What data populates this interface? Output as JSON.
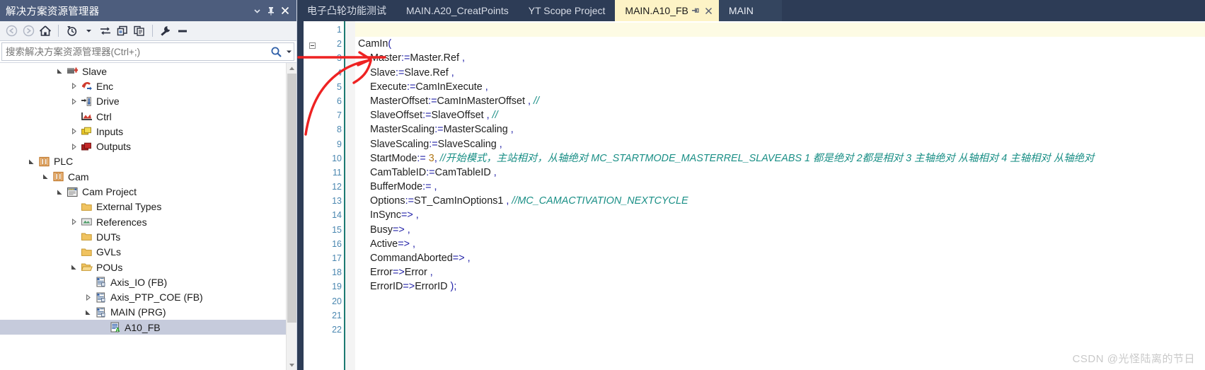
{
  "solution_explorer": {
    "title": "解决方案资源管理器",
    "titlebar_buttons": [
      {
        "name": "dropdown",
        "glyph": "▾"
      },
      {
        "name": "pin",
        "glyph": "⊓"
      },
      {
        "name": "close",
        "glyph": "✕"
      }
    ],
    "toolbar": [
      {
        "name": "back-icon",
        "glyph": "back"
      },
      {
        "name": "forward-icon",
        "glyph": "forward"
      },
      {
        "name": "home-icon",
        "glyph": "home"
      },
      {
        "name": "pending-changes-icon",
        "glyph": "clock"
      },
      {
        "name": "sync-icon",
        "glyph": "sync"
      },
      {
        "name": "show-all-files-icon",
        "glyph": "files"
      },
      {
        "name": "properties-icon",
        "glyph": "copy"
      },
      {
        "name": "tools-icon",
        "glyph": "wrench"
      },
      {
        "name": "collapse-icon",
        "glyph": "dash"
      }
    ],
    "search": {
      "placeholder": "搜索解决方案资源管理器(Ctrl+;)",
      "value": ""
    },
    "tree": [
      {
        "label": "Slave",
        "depth": 3,
        "expander": "expanded",
        "icon": "slave-icon",
        "selected": false
      },
      {
        "label": "Enc",
        "depth": 4,
        "expander": "collapsed",
        "icon": "encoder-icon",
        "selected": false
      },
      {
        "label": "Drive",
        "depth": 4,
        "expander": "collapsed",
        "icon": "drive-icon",
        "selected": false
      },
      {
        "label": "Ctrl",
        "depth": 4,
        "expander": "none",
        "icon": "ctrl-icon",
        "selected": false
      },
      {
        "label": "Inputs",
        "depth": 4,
        "expander": "collapsed",
        "icon": "inputs-icon",
        "selected": false
      },
      {
        "label": "Outputs",
        "depth": 4,
        "expander": "collapsed",
        "icon": "outputs-icon",
        "selected": false
      },
      {
        "label": "PLC",
        "depth": 1,
        "expander": "expanded",
        "icon": "plc-icon",
        "selected": false
      },
      {
        "label": "Cam",
        "depth": 2,
        "expander": "expanded",
        "icon": "plc-icon",
        "selected": false
      },
      {
        "label": "Cam Project",
        "depth": 3,
        "expander": "expanded",
        "icon": "project-icon",
        "selected": false
      },
      {
        "label": "External Types",
        "depth": 4,
        "expander": "none",
        "icon": "folder-icon",
        "selected": false
      },
      {
        "label": "References",
        "depth": 4,
        "expander": "collapsed",
        "icon": "references-icon",
        "selected": false
      },
      {
        "label": "DUTs",
        "depth": 4,
        "expander": "none",
        "icon": "folder-icon",
        "selected": false
      },
      {
        "label": "GVLs",
        "depth": 4,
        "expander": "none",
        "icon": "folder-icon",
        "selected": false
      },
      {
        "label": "POUs",
        "depth": 4,
        "expander": "expanded",
        "icon": "folder-open-icon",
        "selected": false
      },
      {
        "label": "Axis_IO (FB)",
        "depth": 5,
        "expander": "none",
        "icon": "pou-icon",
        "selected": false
      },
      {
        "label": "Axis_PTP_COE (FB)",
        "depth": 5,
        "expander": "collapsed",
        "icon": "pou-icon",
        "selected": false
      },
      {
        "label": "MAIN (PRG)",
        "depth": 5,
        "expander": "expanded",
        "icon": "pou-icon",
        "selected": false
      },
      {
        "label": "A10_FB",
        "depth": 6,
        "expander": "none",
        "icon": "action-icon",
        "selected": true
      }
    ]
  },
  "tabs": [
    {
      "label": "电子凸轮功能测试",
      "state": "inactive",
      "pinned": false,
      "closable": false
    },
    {
      "label": "MAIN.A20_CreatPoints",
      "state": "inactive",
      "pinned": false,
      "closable": false
    },
    {
      "label": "YT Scope Project",
      "state": "inactive",
      "pinned": false,
      "closable": false
    },
    {
      "label": "MAIN.A10_FB",
      "state": "active",
      "pinned": true,
      "closable": true
    },
    {
      "label": "MAIN",
      "state": "current",
      "pinned": false,
      "closable": false
    }
  ],
  "tab_glyphs": {
    "pin": "⊣",
    "close": "✕"
  },
  "editor": {
    "lines": [
      {
        "num": "1",
        "indent": 0,
        "highlight": true,
        "segments": []
      },
      {
        "num": "2",
        "indent": 0,
        "highlight": false,
        "fold": true,
        "segments": [
          {
            "t": "CamIn",
            "c": "plain"
          },
          {
            "t": "(",
            "c": "punc"
          }
        ]
      },
      {
        "num": "3",
        "indent": 1,
        "highlight": false,
        "segments": [
          {
            "t": "Master",
            "c": "plain"
          },
          {
            "t": ":=",
            "c": "op"
          },
          {
            "t": "Master.Ref",
            "c": "plain"
          },
          {
            "t": " ,",
            "c": "punc"
          }
        ]
      },
      {
        "num": "4",
        "indent": 1,
        "highlight": false,
        "segments": [
          {
            "t": "Slave",
            "c": "plain"
          },
          {
            "t": ":=",
            "c": "op"
          },
          {
            "t": "Slave.Ref",
            "c": "plain"
          },
          {
            "t": "  ,",
            "c": "punc"
          }
        ]
      },
      {
        "num": "5",
        "indent": 1,
        "highlight": false,
        "segments": [
          {
            "t": "Execute",
            "c": "plain"
          },
          {
            "t": ":=",
            "c": "op"
          },
          {
            "t": "CamInExecute",
            "c": "plain"
          },
          {
            "t": " ,",
            "c": "punc"
          }
        ]
      },
      {
        "num": "6",
        "indent": 1,
        "highlight": false,
        "segments": [
          {
            "t": "MasterOffset",
            "c": "plain"
          },
          {
            "t": ":=",
            "c": "op"
          },
          {
            "t": "CamInMasterOffset",
            "c": "plain"
          },
          {
            "t": " ,",
            "c": "punc"
          },
          {
            "t": " //",
            "c": "cmt"
          }
        ]
      },
      {
        "num": "7",
        "indent": 1,
        "highlight": false,
        "segments": [
          {
            "t": "SlaveOffset",
            "c": "plain"
          },
          {
            "t": ":=",
            "c": "op"
          },
          {
            "t": "SlaveOffset",
            "c": "plain"
          },
          {
            "t": " ,",
            "c": "punc"
          },
          {
            "t": " //",
            "c": "cmt"
          }
        ]
      },
      {
        "num": "8",
        "indent": 1,
        "highlight": false,
        "segments": [
          {
            "t": "MasterScaling",
            "c": "plain"
          },
          {
            "t": ":=",
            "c": "op"
          },
          {
            "t": "MasterScaling",
            "c": "plain"
          },
          {
            "t": " ,",
            "c": "punc"
          }
        ]
      },
      {
        "num": "9",
        "indent": 1,
        "highlight": false,
        "segments": [
          {
            "t": "SlaveScaling",
            "c": "plain"
          },
          {
            "t": ":=",
            "c": "op"
          },
          {
            "t": "SlaveScaling",
            "c": "plain"
          },
          {
            "t": " ,",
            "c": "punc"
          }
        ]
      },
      {
        "num": "10",
        "indent": 1,
        "highlight": false,
        "segments": [
          {
            "t": "StartMode",
            "c": "plain"
          },
          {
            "t": ":=",
            "c": "op"
          },
          {
            "t": " 3",
            "c": "num"
          },
          {
            "t": ",",
            "c": "punc"
          },
          {
            "t": " //开始模式，主站相对，从轴绝对  MC_STARTMODE_MASTERREL_SLAVEABS  1 都是绝对  2都是相对 3 主轴绝对 从轴相对  4 主轴相对 从轴绝对",
            "c": "cmt"
          }
        ]
      },
      {
        "num": "11",
        "indent": 1,
        "highlight": false,
        "segments": [
          {
            "t": "CamTableID",
            "c": "plain"
          },
          {
            "t": ":=",
            "c": "op"
          },
          {
            "t": "CamTableID",
            "c": "plain"
          },
          {
            "t": " ,",
            "c": "punc"
          }
        ]
      },
      {
        "num": "12",
        "indent": 1,
        "highlight": false,
        "segments": [
          {
            "t": "BufferMode",
            "c": "plain"
          },
          {
            "t": ":=",
            "c": "op"
          },
          {
            "t": " ,",
            "c": "punc"
          }
        ]
      },
      {
        "num": "13",
        "indent": 1,
        "highlight": false,
        "segments": [
          {
            "t": "Options",
            "c": "plain"
          },
          {
            "t": ":=",
            "c": "op"
          },
          {
            "t": "ST_CamInOptions1",
            "c": "plain"
          },
          {
            "t": " ,",
            "c": "punc"
          },
          {
            "t": " //MC_CAMACTIVATION_NEXTCYCLE",
            "c": "cmt"
          }
        ]
      },
      {
        "num": "14",
        "indent": 1,
        "highlight": false,
        "segments": [
          {
            "t": "InSync",
            "c": "plain"
          },
          {
            "t": "=>",
            "c": "op"
          },
          {
            "t": " ,",
            "c": "punc"
          }
        ]
      },
      {
        "num": "15",
        "indent": 1,
        "highlight": false,
        "segments": [
          {
            "t": "Busy",
            "c": "plain"
          },
          {
            "t": "=>",
            "c": "op"
          },
          {
            "t": " ,",
            "c": "punc"
          }
        ]
      },
      {
        "num": "16",
        "indent": 1,
        "highlight": false,
        "segments": [
          {
            "t": "Active",
            "c": "plain"
          },
          {
            "t": "=>",
            "c": "op"
          },
          {
            "t": " ,",
            "c": "punc"
          }
        ]
      },
      {
        "num": "17",
        "indent": 1,
        "highlight": false,
        "segments": [
          {
            "t": "CommandAborted",
            "c": "plain"
          },
          {
            "t": "=>",
            "c": "op"
          },
          {
            "t": " ,",
            "c": "punc"
          }
        ]
      },
      {
        "num": "18",
        "indent": 1,
        "highlight": false,
        "segments": [
          {
            "t": "Error",
            "c": "plain"
          },
          {
            "t": "=>",
            "c": "op"
          },
          {
            "t": "Error",
            "c": "plain"
          },
          {
            "t": " ,",
            "c": "punc"
          }
        ]
      },
      {
        "num": "19",
        "indent": 1,
        "highlight": false,
        "segments": [
          {
            "t": "ErrorID",
            "c": "plain"
          },
          {
            "t": "=>",
            "c": "op"
          },
          {
            "t": "ErrorID",
            "c": "plain"
          },
          {
            "t": " );",
            "c": "punc"
          }
        ]
      },
      {
        "num": "20",
        "indent": 0,
        "highlight": false,
        "segments": []
      },
      {
        "num": "21",
        "indent": 0,
        "highlight": false,
        "segments": []
      },
      {
        "num": "22",
        "indent": 0,
        "highlight": false,
        "segments": []
      }
    ]
  },
  "annotation": {
    "name": "red-arrow-annotation",
    "color": "#ee2222"
  },
  "watermark": "CSDN @光怪陆离的节日",
  "colors": {
    "panel_title_bg": "#4d5d7d",
    "tabstrip_bg": "#2d3c56",
    "active_tab_bg": "#fdf3c6",
    "selection_bg": "#c6cbdc",
    "comment": "#1a8f86",
    "linenum": "#4a87b0"
  }
}
